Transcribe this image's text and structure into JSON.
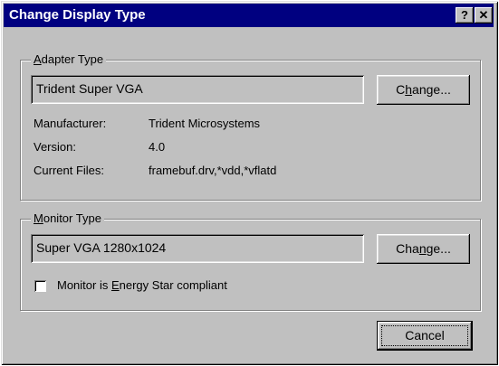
{
  "window": {
    "title": "Change Display Type",
    "help_button": "?",
    "close_button": "✕"
  },
  "adapter": {
    "legend_prefix": "A",
    "legend_rest": "dapter Type",
    "value": "Trident Super VGA",
    "change_pre": "C",
    "change_ul": "h",
    "change_rest": "ange...",
    "manufacturer_label": "Manufacturer:",
    "manufacturer_value": "Trident Microsystems",
    "version_label": "Version:",
    "version_value": "4.0",
    "files_label": "Current Files:",
    "files_value": "framebuf.drv,*vdd,*vflatd"
  },
  "monitor": {
    "legend_prefix": "M",
    "legend_rest": "onitor Type",
    "value": "Super VGA 1280x1024",
    "change_pre": "Cha",
    "change_ul": "n",
    "change_rest": "ge...",
    "energy_pre": "Monitor is ",
    "energy_ul": "E",
    "energy_rest": "nergy Star compliant",
    "energy_checked": false
  },
  "cancel_label": "Cancel"
}
